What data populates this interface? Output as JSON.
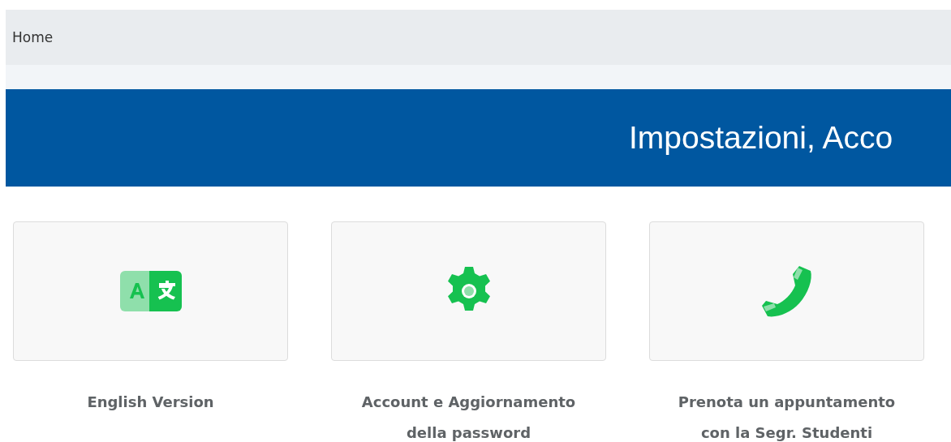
{
  "breadcrumb": {
    "items": [
      "Home"
    ]
  },
  "banner": {
    "title": "Impostazioni, Acco"
  },
  "tiles": [
    {
      "kind": "translate",
      "label": "English Version"
    },
    {
      "kind": "settings",
      "label": "Account e Aggiornamento della password"
    },
    {
      "kind": "phone",
      "label": "Prenota un appuntamento con la Segr. Studenti"
    }
  ]
}
